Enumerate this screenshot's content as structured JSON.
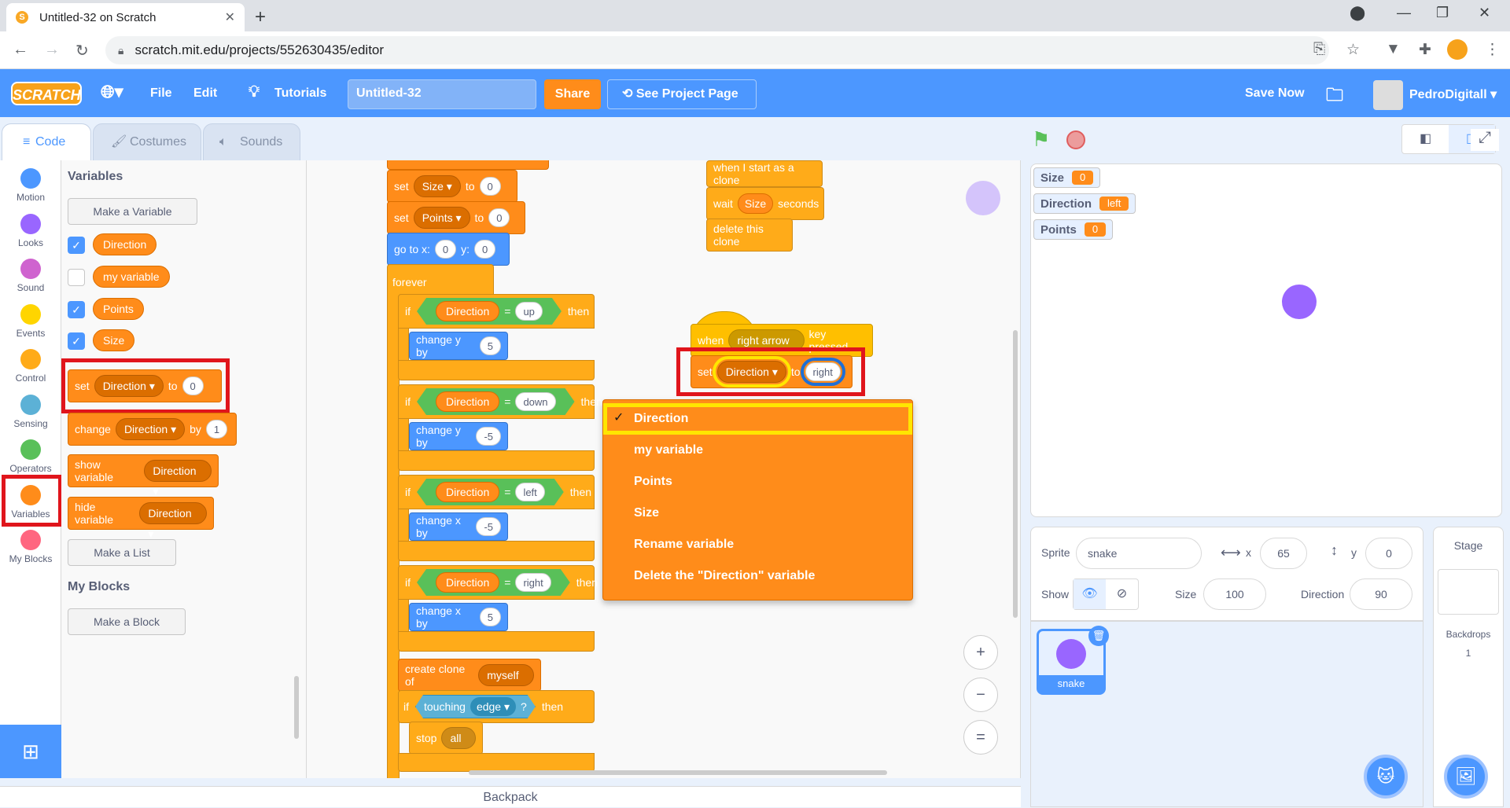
{
  "browser": {
    "tab_title": "Untitled-32 on Scratch",
    "new_tab": "+",
    "url": "scratch.mit.edu/projects/552630435/editor"
  },
  "menubar": {
    "logo": "SCRATCH",
    "file": "File",
    "edit": "Edit",
    "tutorials": "Tutorials",
    "project_title": "Untitled-32",
    "share": "Share",
    "see_project": "See Project Page",
    "save_now": "Save Now",
    "username": "PedroDigitall"
  },
  "editor_tabs": [
    "Code",
    "Costumes",
    "Sounds"
  ],
  "categories": [
    {
      "label": "Motion",
      "color": "#4c97ff"
    },
    {
      "label": "Looks",
      "color": "#9966ff"
    },
    {
      "label": "Sound",
      "color": "#cf63cf"
    },
    {
      "label": "Events",
      "color": "#ffd500"
    },
    {
      "label": "Control",
      "color": "#ffab19"
    },
    {
      "label": "Sensing",
      "color": "#5cb1d6"
    },
    {
      "label": "Operators",
      "color": "#59c059"
    },
    {
      "label": "Variables",
      "color": "#ff8c1a"
    },
    {
      "label": "My Blocks",
      "color": "#ff6680"
    }
  ],
  "flyout": {
    "title": "Variables",
    "make_variable": "Make a Variable",
    "variables": [
      {
        "name": "Direction",
        "checked": true
      },
      {
        "name": "my variable",
        "checked": false
      },
      {
        "name": "Points",
        "checked": true
      },
      {
        "name": "Size",
        "checked": true
      }
    ],
    "set_block": {
      "word": "set",
      "var": "Direction",
      "to": "to",
      "value": "0"
    },
    "change_block": {
      "word": "change",
      "var": "Direction",
      "by": "by",
      "value": "1"
    },
    "show_block": {
      "word": "show variable",
      "var": "Direction"
    },
    "hide_block": {
      "word": "hide variable",
      "var": "Direction"
    },
    "make_list": "Make a List",
    "my_blocks_title": "My Blocks",
    "make_block": "Make a Block"
  },
  "script_main": {
    "set_size": {
      "word": "set",
      "var": "Size",
      "to": "to",
      "value": "0"
    },
    "set_points": {
      "word": "set",
      "var": "Points",
      "to": "to",
      "value": "0"
    },
    "goto": {
      "label": "go to x:",
      "x": "0",
      "ylabel": "y:",
      "y": "0"
    },
    "forever": "forever",
    "if_word": "if",
    "then_word": "then",
    "eq": "=",
    "dir_var": "Direction",
    "if_up": {
      "val": "up",
      "action": "change y by",
      "n": "5"
    },
    "if_down": {
      "val": "down",
      "action": "change y by",
      "n": "-5"
    },
    "if_left": {
      "val": "left",
      "action": "change x by",
      "n": "-5"
    },
    "if_right": {
      "val": "right",
      "action": "change x by",
      "n": "5"
    },
    "create_clone": {
      "label": "create clone of",
      "target": "myself"
    },
    "touching": {
      "label": "touching",
      "target": "edge",
      "q": "?"
    },
    "stop": {
      "label": "stop",
      "target": "all"
    }
  },
  "script_clone": {
    "hat": "when I start as a clone",
    "wait": "wait",
    "wait_var": "Size",
    "seconds": "seconds",
    "delete": "delete this clone"
  },
  "script_key": {
    "when": "when",
    "key": "right arrow",
    "pressed": "key pressed",
    "set": "set",
    "var": "Direction",
    "to": "to",
    "value": "right"
  },
  "dropdown_menu": {
    "check": "✓",
    "items": [
      "Direction",
      "my variable",
      "Points",
      "Size",
      "Rename variable",
      "Delete the \"Direction\" variable"
    ]
  },
  "zoom": {
    "in": "+",
    "out": "−",
    "reset": "="
  },
  "stage": {
    "monitors": [
      {
        "name": "Size",
        "value": "0"
      },
      {
        "name": "Direction",
        "value": "left"
      },
      {
        "name": "Points",
        "value": "0"
      }
    ]
  },
  "sprite_info": {
    "sprite_label": "Sprite",
    "sprite_name": "snake",
    "x_label": "x",
    "x": "65",
    "y_label": "y",
    "y": "0",
    "show_label": "Show",
    "size_label": "Size",
    "size": "100",
    "direction_label": "Direction",
    "direction": "90"
  },
  "sprite_tile": {
    "name": "snake"
  },
  "stage_pane": {
    "title": "Stage",
    "backdrops_label": "Backdrops",
    "backdrops_count": "1"
  },
  "backpack": "Backpack",
  "colors": {
    "menubar": "#4c97ff",
    "variables": "#ff8c1a",
    "highlight_red": "#e0151c",
    "highlight_yellow": "#ffe600"
  }
}
